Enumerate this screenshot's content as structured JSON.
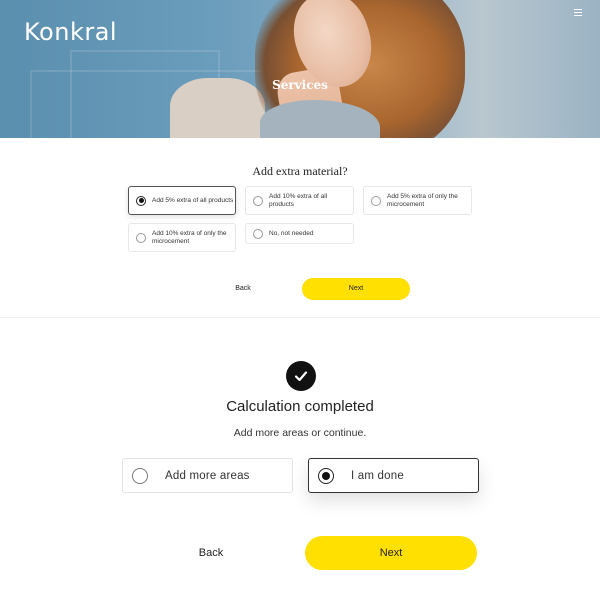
{
  "brand": {
    "logo": "Konkral"
  },
  "header": {
    "title": "Services",
    "menu_icon": "hamburger-menu-icon"
  },
  "step_material": {
    "question": "Add extra material?",
    "options": [
      {
        "label": "Add 5% extra of all products",
        "selected": true
      },
      {
        "label": "Add 10% extra of all products",
        "selected": false
      },
      {
        "label": "Add 5% extra of only the microcement",
        "selected": false
      },
      {
        "label": "Add 10% extra of only the microcement",
        "selected": false
      },
      {
        "label": "No, not needed",
        "selected": false
      }
    ],
    "back_label": "Back",
    "next_label": "Next"
  },
  "completion": {
    "icon": "checkmark-icon",
    "title": "Calculation completed",
    "subtitle": "Add more areas or continue.",
    "options": [
      {
        "label": "Add more areas",
        "selected": false
      },
      {
        "label": "I am done",
        "selected": true
      }
    ],
    "back_label": "Back",
    "next_label": "Next"
  },
  "colors": {
    "accent": "#ffe000",
    "text": "#222222",
    "check_bg": "#111111"
  }
}
